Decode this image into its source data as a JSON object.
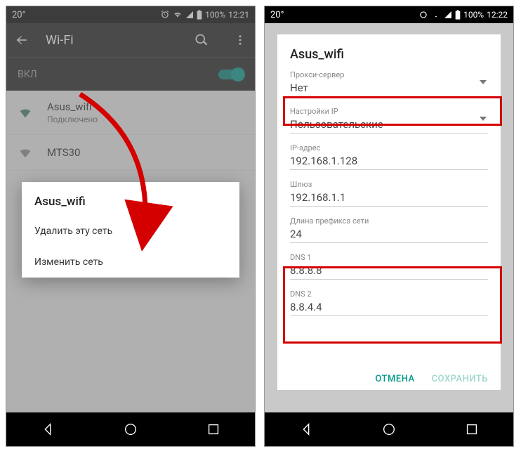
{
  "left": {
    "status": {
      "temp": "20°",
      "battery": "100%",
      "time": "12:21"
    },
    "appbar_title": "Wi-Fi",
    "toggle_label": "ВКЛ",
    "networks": [
      {
        "ssid": "Asus_wifi",
        "sub": "Подключено"
      },
      {
        "ssid": "MTS30",
        "sub": ""
      }
    ],
    "popup": {
      "title": "Asus_wifi",
      "delete": "Удалить эту сеть",
      "modify": "Изменить сеть"
    }
  },
  "right": {
    "status": {
      "temp": "20°",
      "battery": "100%",
      "time": "12:22"
    },
    "dialog": {
      "title": "Asus_wifi",
      "proxy_label": "Прокси-сервер",
      "proxy_value": "Нет",
      "ipset_label": "Настройки IP",
      "ipset_value": "Пользовательские",
      "ip_label": "IP-адрес",
      "ip_value": "192.168.1.128",
      "gw_label": "Шлюз",
      "gw_value": "192.168.1.1",
      "prefix_label": "Длина префикса сети",
      "prefix_value": "24",
      "dns1_label": "DNS 1",
      "dns1_value": "8.8.8.8",
      "dns2_label": "DNS 2",
      "dns2_value": "8.8.4.4",
      "cancel": "ОТМЕНА",
      "save": "СОХРАНИТЬ"
    }
  }
}
